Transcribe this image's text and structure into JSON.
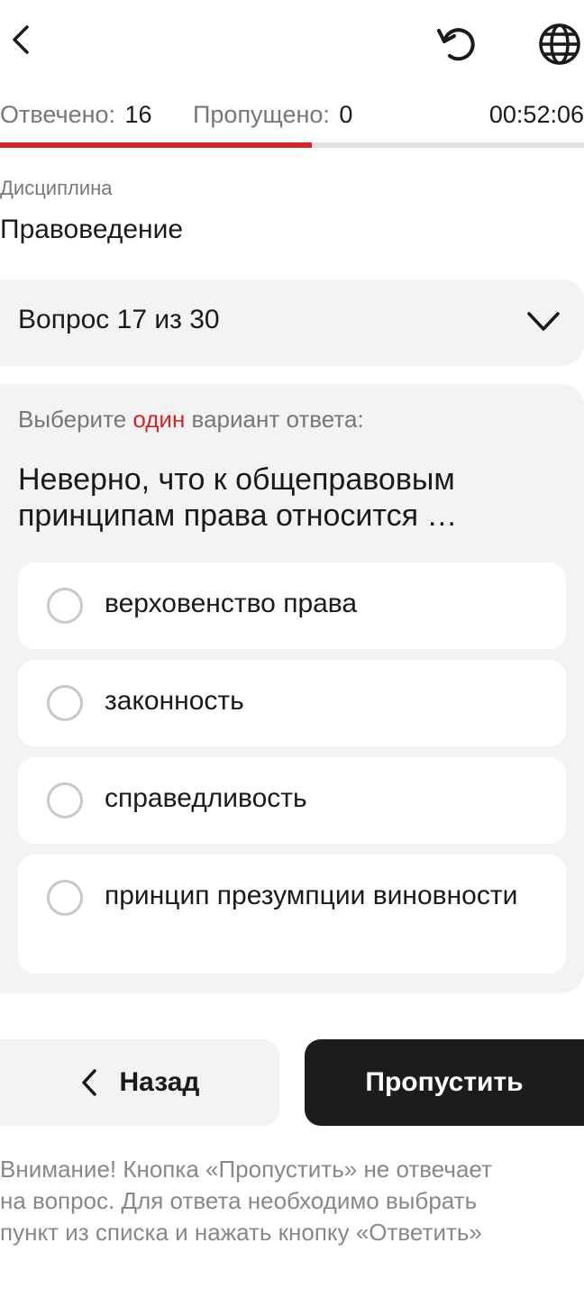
{
  "header": {
    "back_icon": "chevron-left-icon",
    "reset_icon": "refresh-icon",
    "language_icon": "globe-icon"
  },
  "stats": {
    "answered_label": "Отвечено:",
    "answered_value": "16",
    "skipped_label": "Пропущено:",
    "skipped_value": "0",
    "timer": "00:52:06"
  },
  "progress": {
    "fraction": 0.5333
  },
  "discipline": {
    "label": "Дисциплина",
    "value": "Правоведение"
  },
  "question_selector": {
    "label": "Вопрос 17 из 30",
    "icon": "chevron-down-icon"
  },
  "question": {
    "instruction_before": "Выберите ",
    "instruction_accent": "один",
    "instruction_after": " вариант ответа:",
    "text": "Неверно, что к общеправовым принципам права относится …",
    "options": [
      {
        "label": "верховенство права"
      },
      {
        "label": "законность"
      },
      {
        "label": "справедливость"
      },
      {
        "label": "принцип презумпции виновности"
      }
    ]
  },
  "actions": {
    "back_label": "Назад",
    "skip_label": "Пропустить"
  },
  "notice": "Внимание! Кнопка «Пропустить» не отвечает\nна вопрос. Для ответа необходимо выбрать\nпункт из списка и нажать кнопку «Ответить»",
  "colors": {
    "accent": "#d3262b",
    "dark_button": "#1c1c1c",
    "card_bg": "#f3f3f3"
  }
}
